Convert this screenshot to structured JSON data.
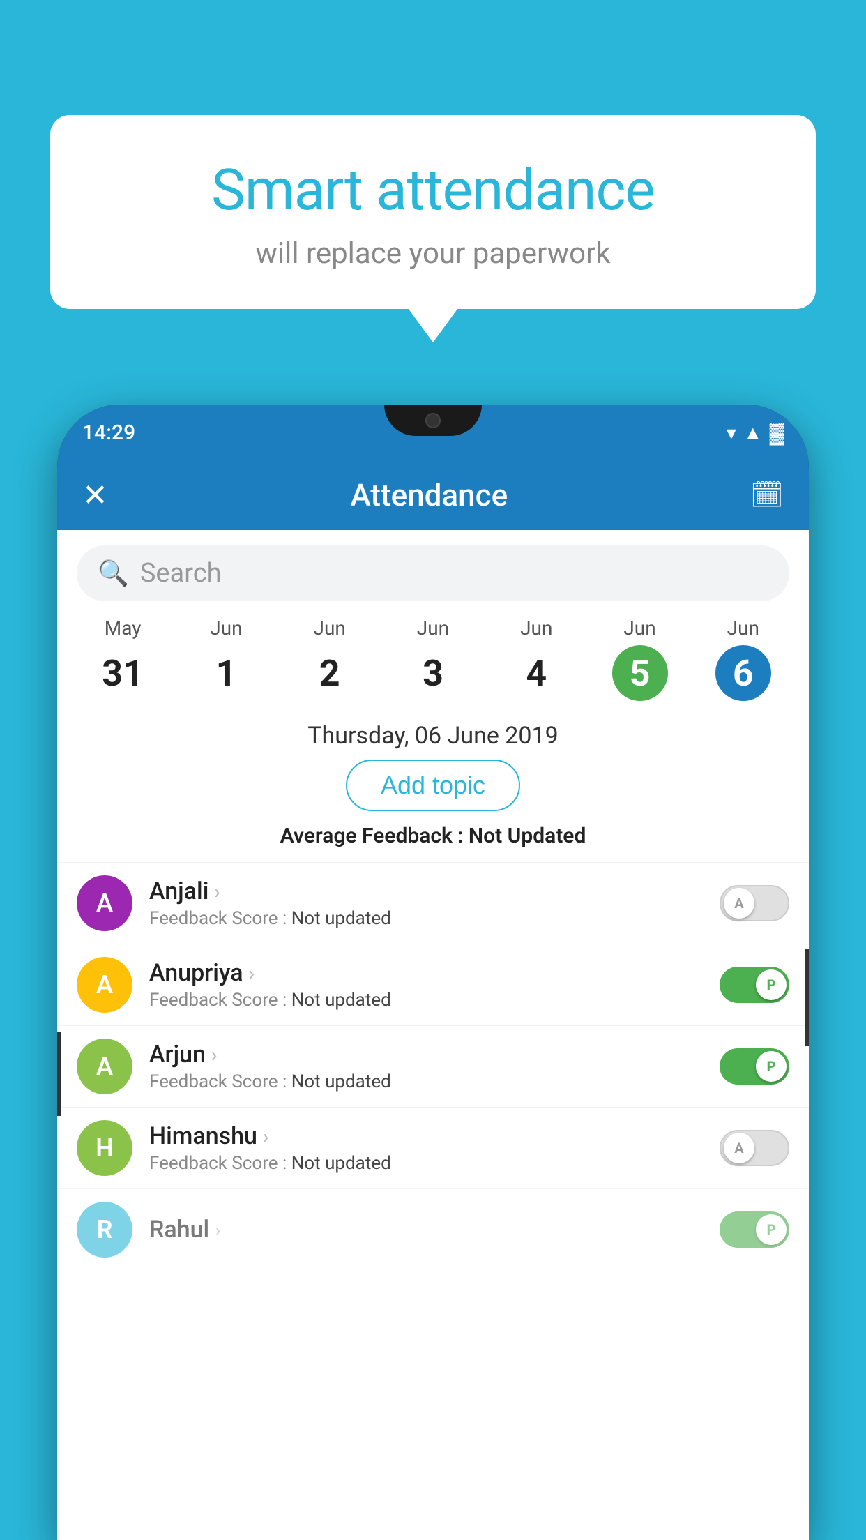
{
  "background_color": "#29B6D8",
  "bubble": {
    "title": "Smart attendance",
    "subtitle": "will replace your paperwork"
  },
  "status_bar": {
    "time": "14:29",
    "icons": [
      "▾",
      "▲",
      "🔋"
    ]
  },
  "app_header": {
    "title": "Attendance",
    "close_icon": "✕",
    "calendar_icon": "📅"
  },
  "search": {
    "placeholder": "Search"
  },
  "dates": [
    {
      "month": "May",
      "day": "31",
      "state": "normal"
    },
    {
      "month": "Jun",
      "day": "1",
      "state": "normal"
    },
    {
      "month": "Jun",
      "day": "2",
      "state": "normal"
    },
    {
      "month": "Jun",
      "day": "3",
      "state": "normal"
    },
    {
      "month": "Jun",
      "day": "4",
      "state": "normal"
    },
    {
      "month": "Jun",
      "day": "5",
      "state": "today"
    },
    {
      "month": "Jun",
      "day": "6",
      "state": "selected"
    }
  ],
  "selected_date": "Thursday, 06 June 2019",
  "add_topic_label": "Add topic",
  "average_feedback_label": "Average Feedback : ",
  "average_feedback_value": "Not Updated",
  "students": [
    {
      "name": "Anjali",
      "avatar_letter": "A",
      "avatar_color": "#9C27B0",
      "feedback_label": "Feedback Score : ",
      "feedback_value": "Not updated",
      "toggle_state": "off",
      "toggle_label": "A"
    },
    {
      "name": "Anupriya",
      "avatar_letter": "A",
      "avatar_color": "#FFC107",
      "feedback_label": "Feedback Score : ",
      "feedback_value": "Not updated",
      "toggle_state": "on",
      "toggle_label": "P"
    },
    {
      "name": "Arjun",
      "avatar_letter": "A",
      "avatar_color": "#8BC34A",
      "feedback_label": "Feedback Score : ",
      "feedback_value": "Not updated",
      "toggle_state": "on",
      "toggle_label": "P"
    },
    {
      "name": "Himanshu",
      "avatar_letter": "H",
      "avatar_color": "#8BC34A",
      "feedback_label": "Feedback Score : ",
      "feedback_value": "Not updated",
      "toggle_state": "off",
      "toggle_label": "A"
    }
  ]
}
